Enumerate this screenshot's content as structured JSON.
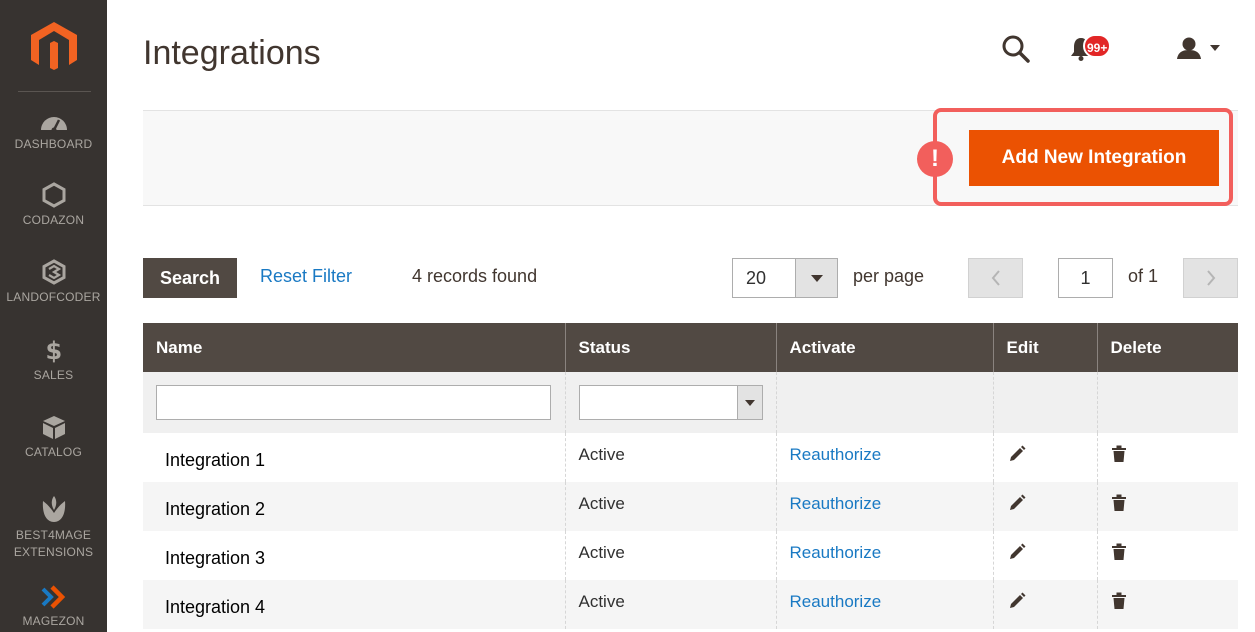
{
  "sidebar": {
    "items": [
      {
        "label": "DASHBOARD",
        "icon": "dashboard-gauge-icon"
      },
      {
        "label": "CODAZON",
        "icon": "hexagon-icon"
      },
      {
        "label": "LANDOFCODER",
        "icon": "landofcoder-logo-icon"
      },
      {
        "label": "SALES",
        "icon": "dollar-icon"
      },
      {
        "label": "CATALOG",
        "icon": "cube-icon"
      },
      {
        "label": "BEST4MAGE EXTENSIONS",
        "line1": "BEST4MAGE",
        "line2": "EXTENSIONS",
        "icon": "tulip-icon"
      },
      {
        "label": "MAGEZON",
        "icon": "magezon-logo-icon"
      }
    ]
  },
  "header": {
    "title": "Integrations",
    "notification_count": "99+"
  },
  "actions": {
    "add_new": "Add New Integration",
    "alert_symbol": "!"
  },
  "toolbar": {
    "search_label": "Search",
    "reset_filter_label": "Reset Filter",
    "records_found": "4 records found",
    "per_page_value": "20",
    "per_page_label": "per page",
    "current_page": "1",
    "of_pages": "of 1"
  },
  "table": {
    "columns": [
      "Name",
      "Status",
      "Activate",
      "Edit",
      "Delete"
    ],
    "rows": [
      {
        "name": "Integration 1",
        "status": "Active",
        "activate": "Reauthorize"
      },
      {
        "name": "Integration 2",
        "status": "Active",
        "activate": "Reauthorize"
      },
      {
        "name": "Integration 3",
        "status": "Active",
        "activate": "Reauthorize"
      },
      {
        "name": "Integration 4",
        "status": "Active",
        "activate": "Reauthorize"
      }
    ]
  },
  "colors": {
    "sidebar_bg": "#373330",
    "primary": "#eb5202",
    "header_row": "#514943",
    "link": "#1979c3",
    "highlight": "#f25f5c"
  }
}
